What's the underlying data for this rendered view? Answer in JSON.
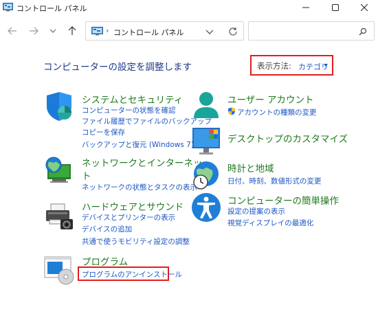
{
  "window": {
    "title": "コントロール パネル"
  },
  "address": {
    "crumb": "コントロール パネル"
  },
  "search": {
    "placeholder": ""
  },
  "header": {
    "page_title": "コンピューターの設定を調整します",
    "view_by_label": "表示方法:",
    "view_by_value": "カテゴリ"
  },
  "categories": {
    "system": {
      "title": "システムとセキュリティ",
      "links": [
        "コンピューターの状態を確認",
        "ファイル履歴でファイルのバックアップ",
        "コピーを保存",
        "バックアップと復元 (Windows 7)"
      ]
    },
    "network": {
      "title_line1": "ネットワークとインターネッ",
      "title_line2": "ト",
      "links": [
        "ネットワークの状態とタスクの表示"
      ]
    },
    "hardware": {
      "title": "ハードウェアとサウンド",
      "links": [
        "デバイスとプリンターの表示",
        "デバイスの追加",
        "共通で使うモビリティ設定の調整"
      ]
    },
    "programs": {
      "title": "プログラム",
      "links": [
        "プログラムのアンインストール"
      ]
    },
    "users": {
      "title": "ユーザー アカウント",
      "links": [
        "アカウントの種類の変更"
      ]
    },
    "appearance": {
      "title": "デスクトップのカスタマイズ"
    },
    "clock": {
      "title": "時計と地域",
      "links": [
        "日付、時刻、数値形式の変更"
      ]
    },
    "ease": {
      "title": "コンピューターの簡単操作",
      "links": [
        "設定の提案の表示",
        "視覚ディスプレイの最適化"
      ]
    }
  },
  "colors": {
    "category_title": "#1e7a1e",
    "link": "#1a56c4",
    "page_title": "#1e3a8a",
    "highlight_box": "#e31d1d"
  }
}
